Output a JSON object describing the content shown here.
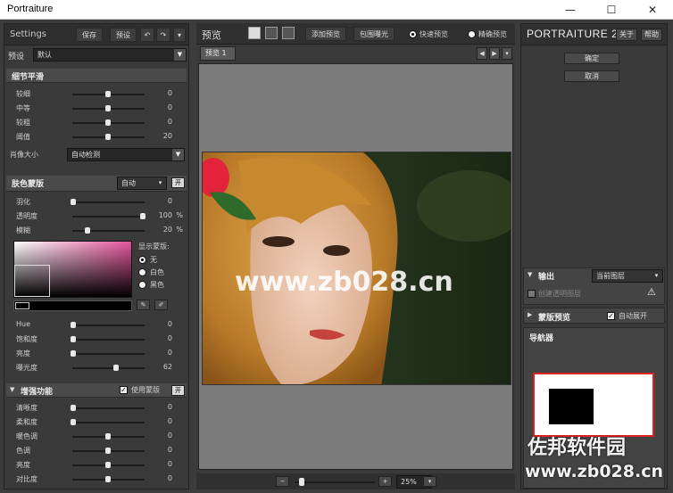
{
  "window": {
    "title": "Portraiture",
    "minimize": "—",
    "maximize": "☐",
    "close": "✕"
  },
  "left": {
    "settings_label": "Settings",
    "save_label": "保存",
    "preset_label": "预设",
    "undo": "↶",
    "redo": "↷",
    "menu": "▾",
    "preset_row_label": "预设",
    "preset_value": "默认",
    "detail": {
      "title": "细节平滑",
      "rows": [
        {
          "label": "较细",
          "value": "0",
          "level": 0.5
        },
        {
          "label": "中等",
          "value": "0",
          "level": 0.5
        },
        {
          "label": "较粗",
          "value": "0",
          "level": 0.5
        },
        {
          "label": "阈值",
          "value": "20",
          "level": 0.5
        }
      ],
      "portrait_size_label": "肖像大小",
      "portrait_size_value": "自动检测"
    },
    "skin": {
      "title": "肤色蒙版",
      "mode_value": "自动",
      "toggle_label": "开",
      "rows": [
        {
          "label": "羽化",
          "value": "0",
          "unit": "",
          "level": 0.0
        },
        {
          "label": "透明度",
          "value": "100",
          "unit": "%",
          "level": 1.0
        },
        {
          "label": "模糊",
          "value": "20",
          "unit": "%",
          "level": 0.2
        }
      ],
      "show_mask_label": "显示蒙版:",
      "options": [
        "无",
        "白色",
        "黑色"
      ],
      "selected_option": "无",
      "bottom_rows": [
        {
          "label": "Hue",
          "value": "0",
          "level": 0.0
        },
        {
          "label": "饱和度",
          "value": "0",
          "level": 0.0
        },
        {
          "label": "亮度",
          "value": "0",
          "level": 0.0
        },
        {
          "label": "曝光度",
          "value": "62",
          "level": 0.62
        }
      ]
    },
    "enhance": {
      "title": "增强功能",
      "use_mask_label": "使用蒙版",
      "toggle_label": "开",
      "rows": [
        {
          "label": "清晰度",
          "value": "0",
          "level": 0.0
        },
        {
          "label": "柔和度",
          "value": "0",
          "level": 0.0
        },
        {
          "label": "暖色调",
          "value": "0",
          "level": 0.5
        },
        {
          "label": "色调",
          "value": "0",
          "level": 0.5
        },
        {
          "label": "亮度",
          "value": "0",
          "level": 0.5
        },
        {
          "label": "对比度",
          "value": "0",
          "level": 0.5
        }
      ]
    }
  },
  "center": {
    "preview_label": "预览",
    "add_preview": "添加预览",
    "show_clipping": "包围曝光",
    "fast_preview": "快速预览",
    "accurate_preview": "精确预览",
    "tab_label": "预览 1",
    "nav_left": "◀",
    "nav_right": "▶",
    "nav_menu": "▾",
    "zoom_out": "−",
    "zoom_in": "+",
    "zoom_value": "25%",
    "zoom_level": 0.05
  },
  "right": {
    "brand_small": "Portraiture",
    "brand_num": "2",
    "about": "关于",
    "help": "帮助",
    "ok": "确定",
    "cancel": "取消",
    "output_title": "输出",
    "output_value": "当前图层",
    "create_layer_label": "创建透明图层",
    "mask_preview_title": "蒙版预览",
    "auto_expand_label": "自动展开",
    "navigator_title": "导航器"
  },
  "watermarks": {
    "center_text": "www.zb028.cn",
    "corner_title": "佐邦软件园",
    "corner_url": "www.zb028.cn"
  }
}
